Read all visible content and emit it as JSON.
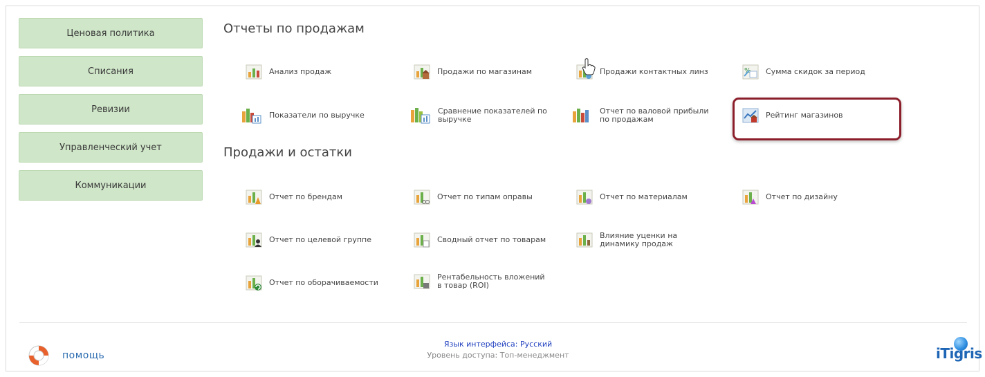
{
  "sidebar": {
    "items": [
      {
        "label": "Ценовая политика"
      },
      {
        "label": "Списания"
      },
      {
        "label": "Ревизии"
      },
      {
        "label": "Управленческий учет"
      },
      {
        "label": "Коммуникации"
      }
    ]
  },
  "sections": {
    "sales_title": "Отчеты по продажам",
    "stock_title": "Продажи и остатки"
  },
  "sales_reports": [
    {
      "label": "Анализ продаж",
      "icon": "bar-chart-icon"
    },
    {
      "label": "Продажи по магазинам",
      "icon": "store-chart-icon"
    },
    {
      "label": "Продажи контактных линз",
      "icon": "lens-chart-icon"
    },
    {
      "label": "Сумма скидок за период",
      "icon": "discount-icon"
    },
    {
      "label": "Показатели по выручке",
      "icon": "revenue-chart-icon"
    },
    {
      "label": "Сравнение показателей по выручке",
      "icon": "compare-chart-icon"
    },
    {
      "label": "Отчет по валовой прибыли по продажам",
      "icon": "profit-chart-icon"
    },
    {
      "label": "Рейтинг магазинов",
      "icon": "store-rating-icon"
    }
  ],
  "stock_reports": [
    {
      "label": "Отчет по брендам",
      "icon": "brand-chart-icon"
    },
    {
      "label": "Отчет по типам оправы",
      "icon": "frame-type-chart-icon"
    },
    {
      "label": "Отчет по материалам",
      "icon": "material-chart-icon"
    },
    {
      "label": "Отчет по дизайну",
      "icon": "design-chart-icon"
    },
    {
      "label": "Отчет по целевой группе",
      "icon": "target-group-chart-icon"
    },
    {
      "label": "Сводный отчет по товарам",
      "icon": "summary-chart-icon"
    },
    {
      "label": "Влияние уценки на динамику продаж",
      "icon": "markdown-chart-icon"
    },
    {
      "label": "Отчет по оборачиваемости",
      "icon": "turnover-chart-icon"
    },
    {
      "label": "Рентабельность вложений в товар (ROI)",
      "icon": "roi-chart-icon"
    }
  ],
  "footer": {
    "help_label": "помощь",
    "language": "Язык интерфейса: Русский",
    "access_level": "Уровень доступа: Топ-менеджмент",
    "logo_text": "iTigris"
  },
  "colors": {
    "nav_bg": "#cfe6c8",
    "highlight": "#8b1e2a",
    "link_blue": "#1f3fbf"
  }
}
